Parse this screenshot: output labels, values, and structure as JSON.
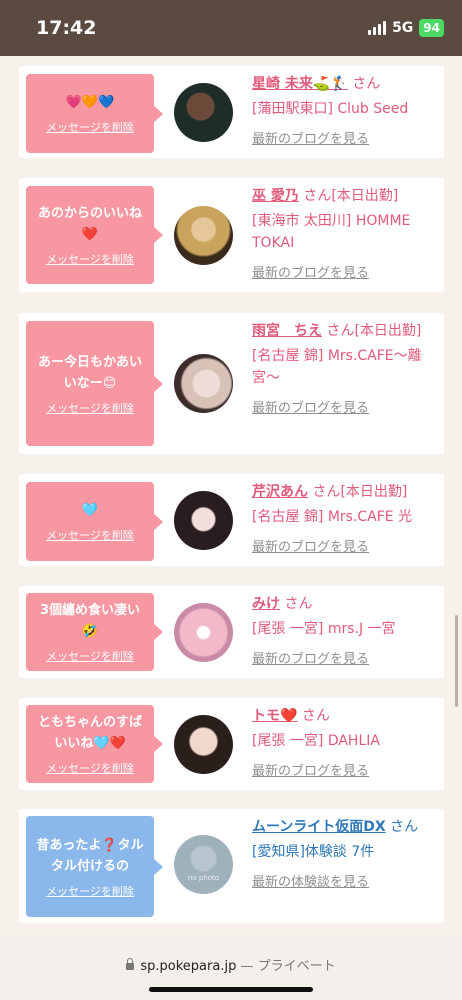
{
  "status_bar": {
    "time": "17:42",
    "network": "5G",
    "battery": "94"
  },
  "cards": [
    {
      "message": "💗🧡💙",
      "delete": "メッセージを削除",
      "name": "星崎 未来⛳️🏌️",
      "san": "さん",
      "shop": "[蒲田駅東口] Club Seed",
      "link": "最新のブログを見る",
      "bubble_color": "pink",
      "avatar_colors": [
        "#1f2d28",
        "#5b3b2b"
      ]
    },
    {
      "message": "あのからのいいね❤️",
      "delete": "メッセージを削除",
      "name": "巫 愛乃",
      "san": "さん[本日出勤]",
      "shop": "[東海市 太田川] HOMME TOKAI",
      "link": "最新のブログを見る",
      "bubble_color": "pink",
      "avatar_colors": [
        "#c9a45c",
        "#3a2a1c"
      ]
    },
    {
      "message": "あー今日もかあいいなー😊",
      "delete": "メッセージを削除",
      "name": "雨宮　ちえ",
      "san": "さん[本日出勤]",
      "shop": "[名古屋 錦] Mrs.CAFE〜離宮〜",
      "link": "最新のブログを見る",
      "bubble_color": "pink",
      "avatar_colors": [
        "#d8c2b8",
        "#3c2c2a"
      ]
    },
    {
      "message": "🩵",
      "delete": "メッセージを削除",
      "name": "芹沢あん",
      "san": "さん[本日出勤]",
      "shop": "[名古屋 錦] Mrs.CAFE 光",
      "link": "最新のブログを見る",
      "bubble_color": "pink",
      "avatar_colors": [
        "#e5c7cd",
        "#2a1d1f"
      ]
    },
    {
      "message": "3個纏め食い凄い🤣",
      "delete": "メッセージを削除",
      "name": "みけ",
      "san": "さん",
      "shop": "[尾張 一宮] mrs.J 一宮",
      "link": "最新のブログを見る",
      "bubble_color": "pink",
      "avatar_colors": [
        "#f2b9c8",
        "#c98aa5"
      ]
    },
    {
      "message": "ともちゃんのすばいいね🩵❤️",
      "delete": "メッセージを削除",
      "name": "トモ❤️",
      "san": "さん",
      "shop": "[尾張 一宮] DAHLIA",
      "link": "最新のブログを見る",
      "bubble_color": "pink",
      "avatar_colors": [
        "#d9b7a8",
        "#2b1f1c"
      ]
    },
    {
      "message": "昔あったよ❓タルタル付けるの",
      "delete": "メッセージを削除",
      "name": "ムーンライト仮面DX",
      "san": "さん",
      "shop": "[愛知県]体験談 7件",
      "link": "最新の体験談を見る",
      "bubble_color": "blue",
      "avatar_colors": [
        "#9fb1bb",
        "#7d93a0"
      ],
      "avatar_label": "no photo"
    }
  ],
  "browser": {
    "url": "sp.pokepara.jp",
    "separator": "—",
    "mode": "プライベート"
  },
  "colors": {
    "pink_accent": "#e05a7a",
    "blue_accent": "#2f77b8",
    "pink_bubble": "#f797a1",
    "blue_bubble": "#8bb8ea",
    "background": "#f6f1ea",
    "status_bar": "#5a4a3f"
  }
}
